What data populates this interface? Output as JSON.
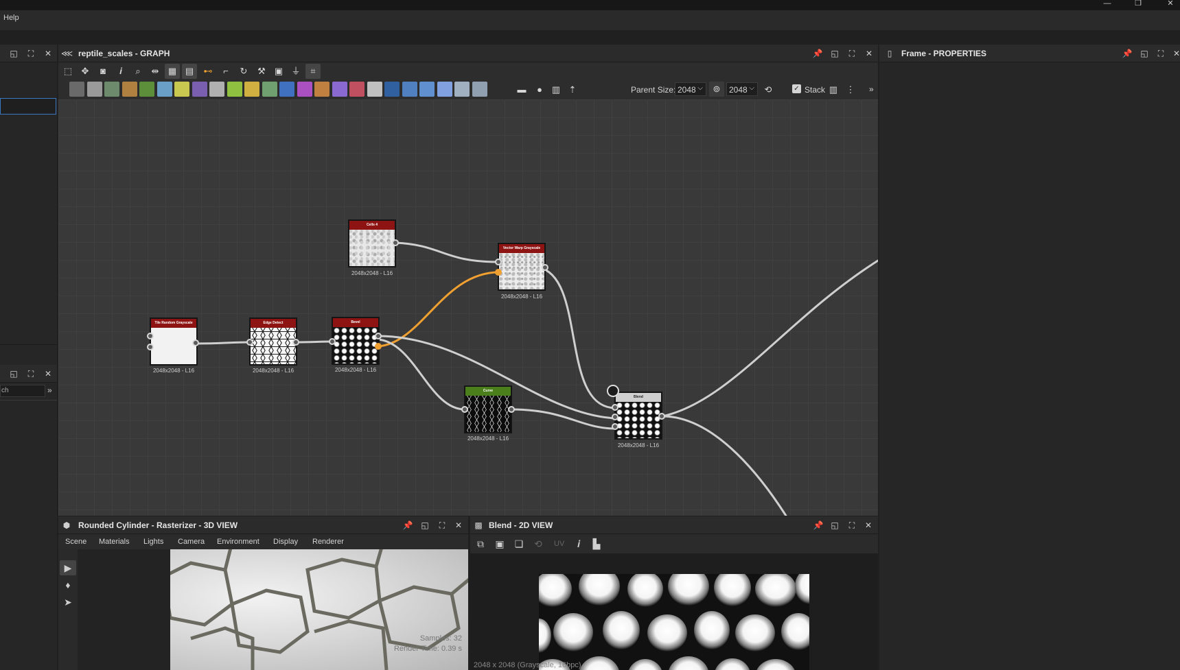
{
  "app": {
    "menu": [
      "Help"
    ],
    "window_controls": [
      "minimize-icon",
      "restore-icon",
      "close-icon"
    ]
  },
  "left_panel": {
    "search_placeholder": "ch",
    "expand_glyph": "»"
  },
  "graph_panel": {
    "title": "reptile_scales - GRAPH",
    "parent_size_label": "Parent Size:",
    "parent_size_value": "2048",
    "size_value_2": "2048",
    "stack_label": "Stack",
    "stack_checked": true,
    "overflow_glyph": "»",
    "toolbar_icons": [
      "frame-all-icon",
      "pan-icon",
      "camera-icon",
      "info-icon",
      "zoom-icon",
      "align-icon",
      "layout-icon",
      "stack-icon",
      "link-icon",
      "path-icon",
      "rotate-icon",
      "tool-icon",
      "preview-icon",
      "brush-icon",
      "frame-icon"
    ],
    "palette_colors": [
      "#6a6a6a",
      "#9a9a9a",
      "#6d8a6d",
      "#b08040",
      "#5d8f3a",
      "#6aa0c8",
      "#c8c850",
      "#7a5fb0",
      "#b0b0b0",
      "#90c040",
      "#d0b040",
      "#70a070",
      "#4070c0",
      "#aa50c0",
      "#c08040",
      "#8a6ad0",
      "#c05060",
      "#c0c0c0",
      "#3060a0",
      "#5080c0",
      "#6090d0",
      "#80a0e0",
      "#a0b0c0",
      "#90a0b0"
    ]
  },
  "nodes": [
    {
      "title": "Cells 4",
      "res": "2048x2048 - L16",
      "header": "red",
      "pattern": "cells"
    },
    {
      "title": "Vector Warp Grayscale",
      "res": "2048x2048 - L16",
      "header": "red",
      "pattern": "cells"
    },
    {
      "title": "Tile Random Grayscale",
      "res": "2048x2048 - L16",
      "header": "red",
      "pattern": "white"
    },
    {
      "title": "Edge Detect",
      "res": "2048x2048 - L16",
      "header": "red",
      "pattern": "edges"
    },
    {
      "title": "Bevel",
      "res": "2048x2048 - L16",
      "header": "red",
      "pattern": "hex"
    },
    {
      "title": "Curve",
      "res": "2048x2048 - L16",
      "header": "green",
      "pattern": "dark"
    },
    {
      "title": "Blend",
      "res": "2048x2048 - L16",
      "header": "gray",
      "pattern": "hex"
    }
  ],
  "properties_panel": {
    "title": "Frame - PROPERTIES"
  },
  "view3d": {
    "title": "Rounded Cylinder - Rasterizer - 3D VIEW",
    "tabs": [
      "Scene",
      "Materials",
      "Lights",
      "Camera",
      "Environment",
      "Display",
      "Renderer"
    ],
    "samples": "Samples: 32",
    "render_time": "Render Time: 0.39 s"
  },
  "view2d": {
    "title": "Blend - 2D VIEW",
    "uv_label": "UV",
    "status": "2048 x 2048 (Grayscale, 16bpc)"
  }
}
